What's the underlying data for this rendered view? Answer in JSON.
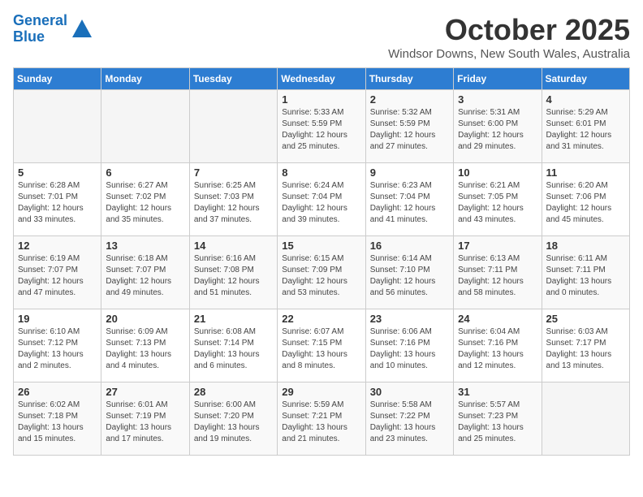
{
  "header": {
    "logo_line1": "General",
    "logo_line2": "Blue",
    "month": "October 2025",
    "location": "Windsor Downs, New South Wales, Australia"
  },
  "weekdays": [
    "Sunday",
    "Monday",
    "Tuesday",
    "Wednesday",
    "Thursday",
    "Friday",
    "Saturday"
  ],
  "weeks": [
    [
      {
        "day": "",
        "info": ""
      },
      {
        "day": "",
        "info": ""
      },
      {
        "day": "",
        "info": ""
      },
      {
        "day": "1",
        "info": "Sunrise: 5:33 AM\nSunset: 5:59 PM\nDaylight: 12 hours\nand 25 minutes."
      },
      {
        "day": "2",
        "info": "Sunrise: 5:32 AM\nSunset: 5:59 PM\nDaylight: 12 hours\nand 27 minutes."
      },
      {
        "day": "3",
        "info": "Sunrise: 5:31 AM\nSunset: 6:00 PM\nDaylight: 12 hours\nand 29 minutes."
      },
      {
        "day": "4",
        "info": "Sunrise: 5:29 AM\nSunset: 6:01 PM\nDaylight: 12 hours\nand 31 minutes."
      }
    ],
    [
      {
        "day": "5",
        "info": "Sunrise: 6:28 AM\nSunset: 7:01 PM\nDaylight: 12 hours\nand 33 minutes."
      },
      {
        "day": "6",
        "info": "Sunrise: 6:27 AM\nSunset: 7:02 PM\nDaylight: 12 hours\nand 35 minutes."
      },
      {
        "day": "7",
        "info": "Sunrise: 6:25 AM\nSunset: 7:03 PM\nDaylight: 12 hours\nand 37 minutes."
      },
      {
        "day": "8",
        "info": "Sunrise: 6:24 AM\nSunset: 7:04 PM\nDaylight: 12 hours\nand 39 minutes."
      },
      {
        "day": "9",
        "info": "Sunrise: 6:23 AM\nSunset: 7:04 PM\nDaylight: 12 hours\nand 41 minutes."
      },
      {
        "day": "10",
        "info": "Sunrise: 6:21 AM\nSunset: 7:05 PM\nDaylight: 12 hours\nand 43 minutes."
      },
      {
        "day": "11",
        "info": "Sunrise: 6:20 AM\nSunset: 7:06 PM\nDaylight: 12 hours\nand 45 minutes."
      }
    ],
    [
      {
        "day": "12",
        "info": "Sunrise: 6:19 AM\nSunset: 7:07 PM\nDaylight: 12 hours\nand 47 minutes."
      },
      {
        "day": "13",
        "info": "Sunrise: 6:18 AM\nSunset: 7:07 PM\nDaylight: 12 hours\nand 49 minutes."
      },
      {
        "day": "14",
        "info": "Sunrise: 6:16 AM\nSunset: 7:08 PM\nDaylight: 12 hours\nand 51 minutes."
      },
      {
        "day": "15",
        "info": "Sunrise: 6:15 AM\nSunset: 7:09 PM\nDaylight: 12 hours\nand 53 minutes."
      },
      {
        "day": "16",
        "info": "Sunrise: 6:14 AM\nSunset: 7:10 PM\nDaylight: 12 hours\nand 56 minutes."
      },
      {
        "day": "17",
        "info": "Sunrise: 6:13 AM\nSunset: 7:11 PM\nDaylight: 12 hours\nand 58 minutes."
      },
      {
        "day": "18",
        "info": "Sunrise: 6:11 AM\nSunset: 7:11 PM\nDaylight: 13 hours\nand 0 minutes."
      }
    ],
    [
      {
        "day": "19",
        "info": "Sunrise: 6:10 AM\nSunset: 7:12 PM\nDaylight: 13 hours\nand 2 minutes."
      },
      {
        "day": "20",
        "info": "Sunrise: 6:09 AM\nSunset: 7:13 PM\nDaylight: 13 hours\nand 4 minutes."
      },
      {
        "day": "21",
        "info": "Sunrise: 6:08 AM\nSunset: 7:14 PM\nDaylight: 13 hours\nand 6 minutes."
      },
      {
        "day": "22",
        "info": "Sunrise: 6:07 AM\nSunset: 7:15 PM\nDaylight: 13 hours\nand 8 minutes."
      },
      {
        "day": "23",
        "info": "Sunrise: 6:06 AM\nSunset: 7:16 PM\nDaylight: 13 hours\nand 10 minutes."
      },
      {
        "day": "24",
        "info": "Sunrise: 6:04 AM\nSunset: 7:16 PM\nDaylight: 13 hours\nand 12 minutes."
      },
      {
        "day": "25",
        "info": "Sunrise: 6:03 AM\nSunset: 7:17 PM\nDaylight: 13 hours\nand 13 minutes."
      }
    ],
    [
      {
        "day": "26",
        "info": "Sunrise: 6:02 AM\nSunset: 7:18 PM\nDaylight: 13 hours\nand 15 minutes."
      },
      {
        "day": "27",
        "info": "Sunrise: 6:01 AM\nSunset: 7:19 PM\nDaylight: 13 hours\nand 17 minutes."
      },
      {
        "day": "28",
        "info": "Sunrise: 6:00 AM\nSunset: 7:20 PM\nDaylight: 13 hours\nand 19 minutes."
      },
      {
        "day": "29",
        "info": "Sunrise: 5:59 AM\nSunset: 7:21 PM\nDaylight: 13 hours\nand 21 minutes."
      },
      {
        "day": "30",
        "info": "Sunrise: 5:58 AM\nSunset: 7:22 PM\nDaylight: 13 hours\nand 23 minutes."
      },
      {
        "day": "31",
        "info": "Sunrise: 5:57 AM\nSunset: 7:23 PM\nDaylight: 13 hours\nand 25 minutes."
      },
      {
        "day": "",
        "info": ""
      }
    ]
  ]
}
